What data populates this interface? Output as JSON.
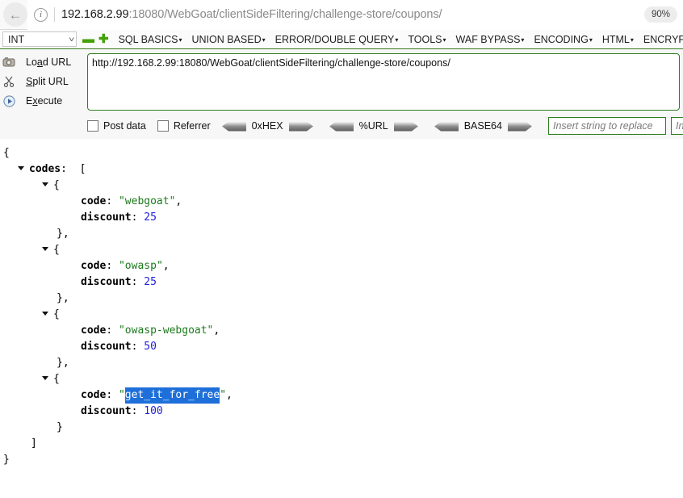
{
  "browser": {
    "back_icon": "back-arrow-icon",
    "info_icon": "site-info-icon",
    "url_host": "192.168.2.99",
    "url_rest": ":18080/WebGoat/clientSideFiltering/challenge-store/coupons/",
    "zoom_level": "90%"
  },
  "hackbar": {
    "type_select": "INT",
    "minus_icon": "minus-icon",
    "plus_icon": "plus-icon",
    "menus": [
      {
        "label": "SQL BASICS",
        "caret": "▾"
      },
      {
        "label": "UNION BASED",
        "caret": "▾"
      },
      {
        "label": "ERROR/DOUBLE QUERY",
        "caret": "▾"
      },
      {
        "label": "TOOLS",
        "caret": "▾"
      },
      {
        "label": "WAF BYPASS",
        "caret": "▾"
      },
      {
        "label": "ENCODING",
        "caret": "▾"
      },
      {
        "label": "HTML",
        "caret": "▾"
      },
      {
        "label": "ENCRYPTION",
        "caret": "▾"
      }
    ],
    "actions": [
      {
        "label": "Load URL",
        "icon": "load-url-icon"
      },
      {
        "label": "Split URL",
        "icon": "scissors-icon"
      },
      {
        "label": "Execute",
        "icon": "play-icon"
      }
    ],
    "url_value": "http://192.168.2.99:18080/WebGoat/clientSideFiltering/challenge-store/coupons/",
    "checkboxes": [
      {
        "label": "Post data",
        "checked": false
      },
      {
        "label": "Referrer",
        "checked": false
      }
    ],
    "encoders": [
      {
        "label": "0xHEX"
      },
      {
        "label": "%URL"
      },
      {
        "label": "BASE64"
      }
    ],
    "replace_find_placeholder": "Insert string to replace",
    "replace_with_placeholder": "Insert rep"
  },
  "json_viewer": {
    "root_open": "{",
    "root_close": "}",
    "array_key": "codes",
    "array_open": "[",
    "array_close": "]",
    "obj_open": "{",
    "obj_close_comma": "},",
    "obj_close": "}",
    "key_code": "code",
    "key_discount": "discount",
    "colon": ":",
    "quote": "\"",
    "comma": ",",
    "entries": [
      {
        "code": "webgoat",
        "discount": "25",
        "selected": false
      },
      {
        "code": "owasp",
        "discount": "25",
        "selected": false
      },
      {
        "code": "owasp-webgoat",
        "discount": "50",
        "selected": false
      },
      {
        "code": "get_it_for_free",
        "discount": "100",
        "selected": true
      }
    ]
  },
  "colors": {
    "accent_green": "#2e7d1f",
    "string_green": "#1c7a1c",
    "number_blue": "#2222dd",
    "selection_blue": "#1e6fd9"
  }
}
